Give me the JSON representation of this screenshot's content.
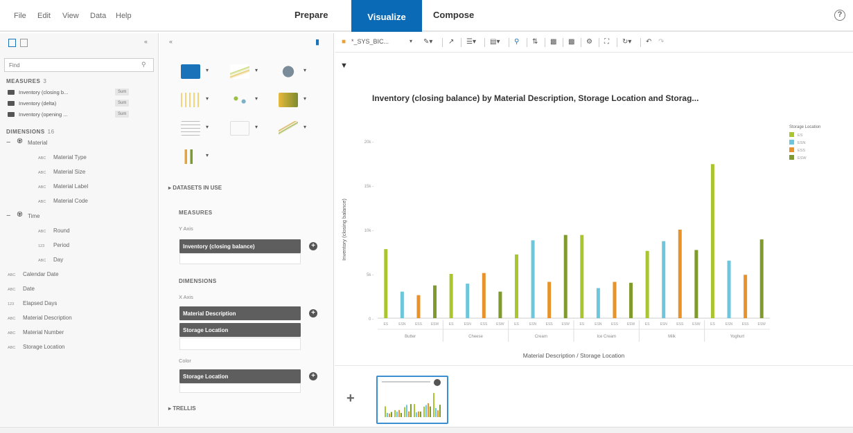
{
  "menu": {
    "items": [
      "File",
      "Edit",
      "View",
      "Data",
      "Help"
    ],
    "modes": [
      "Prepare",
      "Visualize",
      "Compose"
    ],
    "active_mode": "Visualize",
    "help_icon": "help-circle-icon"
  },
  "left_panel": {
    "find_placeholder": "Find",
    "measures_label": "MEASURES",
    "measures_count": "3",
    "measures": [
      {
        "label": "Inventory (closing b...",
        "agg": "Sum"
      },
      {
        "label": "Inventory (delta)",
        "agg": "Sum"
      },
      {
        "label": "Inventory (opening ...",
        "agg": "Sum"
      }
    ],
    "dimensions_label": "DIMENSIONS",
    "dimensions_count": "16",
    "hier_material": "Material",
    "material_children": [
      "Material Type",
      "Material Size",
      "Material Label",
      "Material Code"
    ],
    "hier_time": "Time",
    "time_children": [
      "Round",
      "Period",
      "Day"
    ],
    "time_prefixes": [
      "ABC",
      "123",
      "ABC"
    ],
    "flat_dimensions": [
      "Calendar Date",
      "Date",
      "Elapsed Days",
      "Material Description",
      "Material Number",
      "Storage Location"
    ],
    "flat_prefixes": [
      "ABC",
      "ABC",
      "123",
      "ABC",
      "ABC",
      "ABC"
    ],
    "abc_prefix": "ABC"
  },
  "builder": {
    "datasets_label": "DATASETS IN USE",
    "measures_label": "MEASURES",
    "y_axis_label": "Y Axis",
    "y_axis_value": "Inventory (closing balance)",
    "dimensions_label": "DIMENSIONS",
    "x_axis_label": "X Axis",
    "x_axis_values": [
      "Material Description",
      "Storage Location"
    ],
    "color_label": "Color",
    "color_value": "Storage Location",
    "trellis_label": "TRELLIS"
  },
  "toolbar": {
    "dataset_name": "*_SYS_BIC..."
  },
  "colors": {
    "accent": "#0a6ab6",
    "series": [
      "#a9c52f",
      "#6ec6dc",
      "#e7922a",
      "#7f9a2d"
    ]
  },
  "chart_data": {
    "type": "bar",
    "title": "Inventory (closing balance) by Material Description, Storage Location and Storag...",
    "xlabel": "Material Description / Storage Location",
    "ylabel": "Inventory (closing balance)",
    "legend_title": "Storage Location",
    "legend_position": "top-right",
    "ylim": [
      0,
      20000
    ],
    "y_ticks": [
      "0",
      "5k",
      "10k",
      "15k",
      "20k"
    ],
    "groups": [
      "Butter",
      "Cheese",
      "Cream",
      "Ice Cream",
      "Milk",
      "Yoghurt"
    ],
    "sub_categories": [
      "ES",
      "ESN",
      "ESS",
      "ESW"
    ],
    "series": [
      {
        "name": "ES",
        "values": [
          7800,
          5000,
          7200,
          9400,
          7600,
          17400
        ]
      },
      {
        "name": "ESN",
        "values": [
          3000,
          3900,
          8800,
          3400,
          8700,
          6500
        ]
      },
      {
        "name": "ESS",
        "values": [
          2600,
          5100,
          4100,
          4100,
          10000,
          4900
        ]
      },
      {
        "name": "ESW",
        "values": [
          3700,
          3000,
          9400,
          4000,
          7700,
          8900
        ]
      }
    ]
  }
}
